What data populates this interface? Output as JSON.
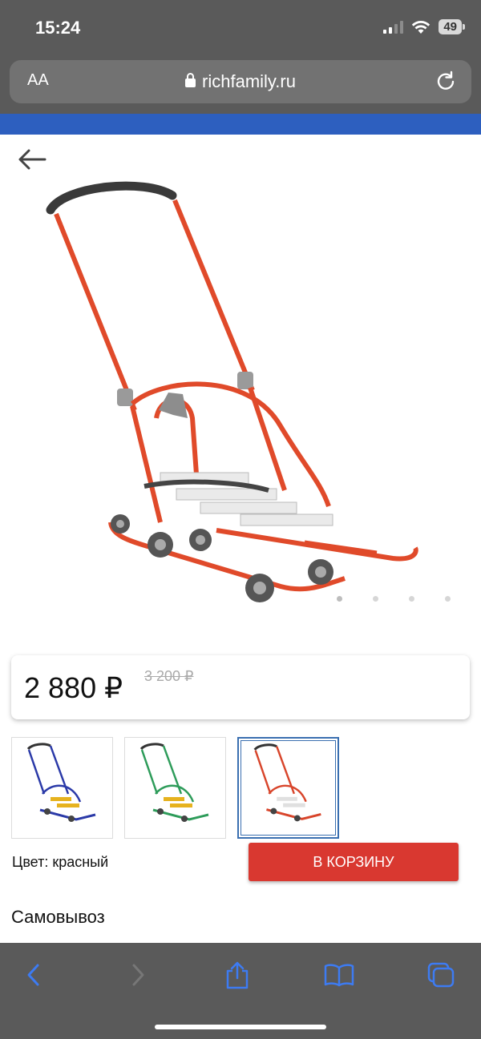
{
  "status_bar": {
    "time": "15:24",
    "battery": "49"
  },
  "browser": {
    "text_size_label": "AA",
    "url": "richfamily.ru"
  },
  "product": {
    "price": "2 880 ₽",
    "old_price": "3 200 ₽",
    "gallery_dots": 4,
    "active_dot": 0,
    "color_label": "Цвет: красный",
    "cart_button": "В КОРЗИНУ",
    "delivery_title": "Самовывоз"
  },
  "variants": [
    {
      "color": "#2b3aa8",
      "accent": "#e6b21e",
      "selected": false
    },
    {
      "color": "#2e9c5a",
      "accent": "#e6b21e",
      "selected": false
    },
    {
      "color": "#d8452b",
      "accent": "#e0e0e0",
      "selected": true
    }
  ],
  "colors": {
    "browser_chrome": "#5a5a5a",
    "site_header": "#2d5fbf",
    "cart_button": "#d93830",
    "toolbar_icons": "#3d7bf2",
    "frame_red": "#e04a2a"
  }
}
